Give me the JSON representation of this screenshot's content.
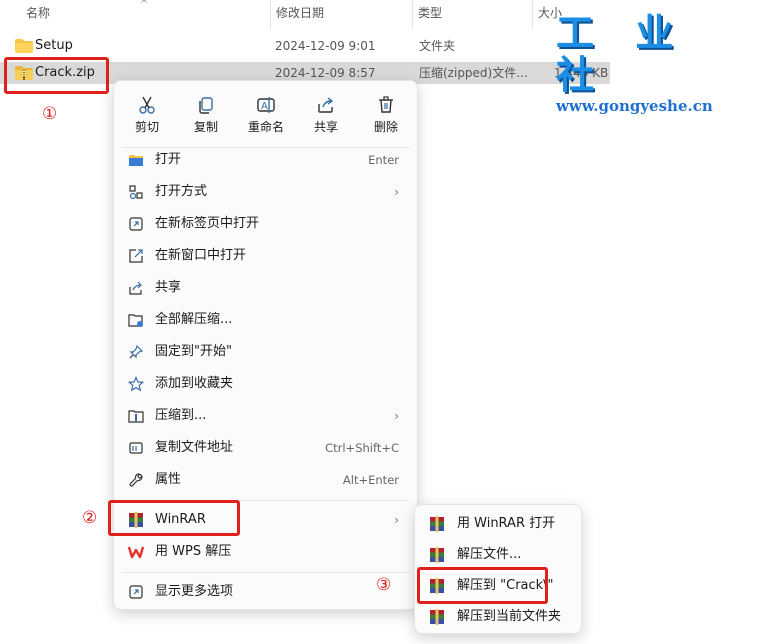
{
  "header": {
    "col_name": "名称",
    "col_modified": "修改日期",
    "col_type": "类型",
    "col_size": "大小"
  },
  "files": [
    {
      "name": "Setup",
      "modified": "2024-12-09 9:01",
      "type": "文件夹",
      "size": ""
    },
    {
      "name": "Crack.zip",
      "modified": "2024-12-09 8:57",
      "type": "压缩(zipped)文件...",
      "size": "1,440 KB"
    }
  ],
  "quick_actions": {
    "cut": "剪切",
    "copy": "复制",
    "rename": "重命名",
    "share": "共享",
    "delete": "删除"
  },
  "menu": {
    "open": "打开",
    "open_shortcut": "Enter",
    "open_with": "打开方式",
    "open_new_tab": "在新标签页中打开",
    "open_new_window": "在新窗口中打开",
    "share": "共享",
    "extract_all": "全部解压缩...",
    "pin_start": "固定到\"开始\"",
    "add_favorites": "添加到收藏夹",
    "compress_to": "压缩到...",
    "copy_path": "复制文件地址",
    "copy_path_shortcut": "Ctrl+Shift+C",
    "properties": "属性",
    "properties_shortcut": "Alt+Enter",
    "winrar": "WinRAR",
    "wps_extract": "用 WPS 解压",
    "more_options": "显示更多选项"
  },
  "winrar_submenu": {
    "open_with_winrar": "用 WinRAR 打开",
    "extract_files": "解压文件...",
    "extract_to_folder": "解压到 \"Crack\\\"",
    "extract_here": "解压到当前文件夹"
  },
  "steps": [
    "①",
    "②",
    "③"
  ],
  "watermark": {
    "title": "工 业 社",
    "url": "www.gongyeshe.cn"
  },
  "colors": {
    "highlight_red": "#e0201b",
    "selection_gray": "#d9d9d9",
    "watermark_blue": "#1c8ee6"
  }
}
